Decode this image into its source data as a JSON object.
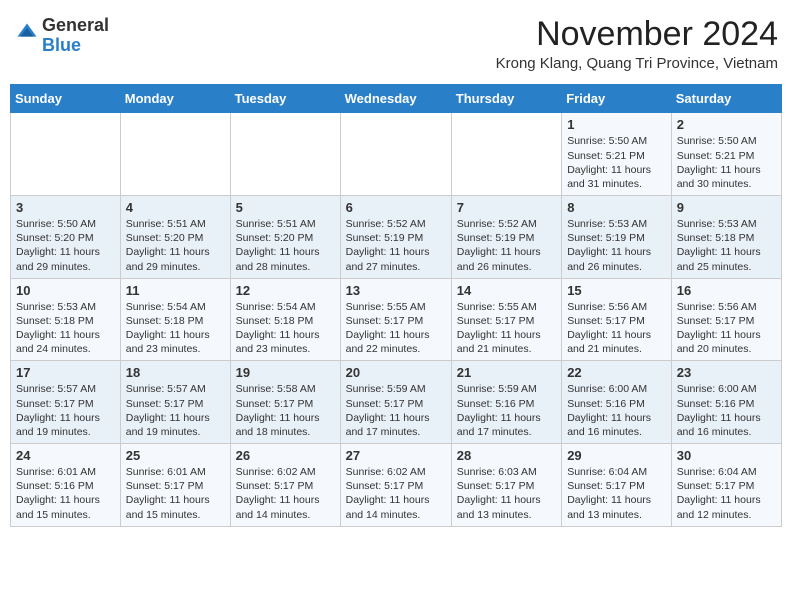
{
  "header": {
    "logo_general": "General",
    "logo_blue": "Blue",
    "month_title": "November 2024",
    "location": "Krong Klang, Quang Tri Province, Vietnam"
  },
  "weekdays": [
    "Sunday",
    "Monday",
    "Tuesday",
    "Wednesday",
    "Thursday",
    "Friday",
    "Saturday"
  ],
  "weeks": [
    [
      {
        "day": "",
        "info": ""
      },
      {
        "day": "",
        "info": ""
      },
      {
        "day": "",
        "info": ""
      },
      {
        "day": "",
        "info": ""
      },
      {
        "day": "",
        "info": ""
      },
      {
        "day": "1",
        "info": "Sunrise: 5:50 AM\nSunset: 5:21 PM\nDaylight: 11 hours and 31 minutes."
      },
      {
        "day": "2",
        "info": "Sunrise: 5:50 AM\nSunset: 5:21 PM\nDaylight: 11 hours and 30 minutes."
      }
    ],
    [
      {
        "day": "3",
        "info": "Sunrise: 5:50 AM\nSunset: 5:20 PM\nDaylight: 11 hours and 29 minutes."
      },
      {
        "day": "4",
        "info": "Sunrise: 5:51 AM\nSunset: 5:20 PM\nDaylight: 11 hours and 29 minutes."
      },
      {
        "day": "5",
        "info": "Sunrise: 5:51 AM\nSunset: 5:20 PM\nDaylight: 11 hours and 28 minutes."
      },
      {
        "day": "6",
        "info": "Sunrise: 5:52 AM\nSunset: 5:19 PM\nDaylight: 11 hours and 27 minutes."
      },
      {
        "day": "7",
        "info": "Sunrise: 5:52 AM\nSunset: 5:19 PM\nDaylight: 11 hours and 26 minutes."
      },
      {
        "day": "8",
        "info": "Sunrise: 5:53 AM\nSunset: 5:19 PM\nDaylight: 11 hours and 26 minutes."
      },
      {
        "day": "9",
        "info": "Sunrise: 5:53 AM\nSunset: 5:18 PM\nDaylight: 11 hours and 25 minutes."
      }
    ],
    [
      {
        "day": "10",
        "info": "Sunrise: 5:53 AM\nSunset: 5:18 PM\nDaylight: 11 hours and 24 minutes."
      },
      {
        "day": "11",
        "info": "Sunrise: 5:54 AM\nSunset: 5:18 PM\nDaylight: 11 hours and 23 minutes."
      },
      {
        "day": "12",
        "info": "Sunrise: 5:54 AM\nSunset: 5:18 PM\nDaylight: 11 hours and 23 minutes."
      },
      {
        "day": "13",
        "info": "Sunrise: 5:55 AM\nSunset: 5:17 PM\nDaylight: 11 hours and 22 minutes."
      },
      {
        "day": "14",
        "info": "Sunrise: 5:55 AM\nSunset: 5:17 PM\nDaylight: 11 hours and 21 minutes."
      },
      {
        "day": "15",
        "info": "Sunrise: 5:56 AM\nSunset: 5:17 PM\nDaylight: 11 hours and 21 minutes."
      },
      {
        "day": "16",
        "info": "Sunrise: 5:56 AM\nSunset: 5:17 PM\nDaylight: 11 hours and 20 minutes."
      }
    ],
    [
      {
        "day": "17",
        "info": "Sunrise: 5:57 AM\nSunset: 5:17 PM\nDaylight: 11 hours and 19 minutes."
      },
      {
        "day": "18",
        "info": "Sunrise: 5:57 AM\nSunset: 5:17 PM\nDaylight: 11 hours and 19 minutes."
      },
      {
        "day": "19",
        "info": "Sunrise: 5:58 AM\nSunset: 5:17 PM\nDaylight: 11 hours and 18 minutes."
      },
      {
        "day": "20",
        "info": "Sunrise: 5:59 AM\nSunset: 5:17 PM\nDaylight: 11 hours and 17 minutes."
      },
      {
        "day": "21",
        "info": "Sunrise: 5:59 AM\nSunset: 5:16 PM\nDaylight: 11 hours and 17 minutes."
      },
      {
        "day": "22",
        "info": "Sunrise: 6:00 AM\nSunset: 5:16 PM\nDaylight: 11 hours and 16 minutes."
      },
      {
        "day": "23",
        "info": "Sunrise: 6:00 AM\nSunset: 5:16 PM\nDaylight: 11 hours and 16 minutes."
      }
    ],
    [
      {
        "day": "24",
        "info": "Sunrise: 6:01 AM\nSunset: 5:16 PM\nDaylight: 11 hours and 15 minutes."
      },
      {
        "day": "25",
        "info": "Sunrise: 6:01 AM\nSunset: 5:17 PM\nDaylight: 11 hours and 15 minutes."
      },
      {
        "day": "26",
        "info": "Sunrise: 6:02 AM\nSunset: 5:17 PM\nDaylight: 11 hours and 14 minutes."
      },
      {
        "day": "27",
        "info": "Sunrise: 6:02 AM\nSunset: 5:17 PM\nDaylight: 11 hours and 14 minutes."
      },
      {
        "day": "28",
        "info": "Sunrise: 6:03 AM\nSunset: 5:17 PM\nDaylight: 11 hours and 13 minutes."
      },
      {
        "day": "29",
        "info": "Sunrise: 6:04 AM\nSunset: 5:17 PM\nDaylight: 11 hours and 13 minutes."
      },
      {
        "day": "30",
        "info": "Sunrise: 6:04 AM\nSunset: 5:17 PM\nDaylight: 11 hours and 12 minutes."
      }
    ]
  ]
}
